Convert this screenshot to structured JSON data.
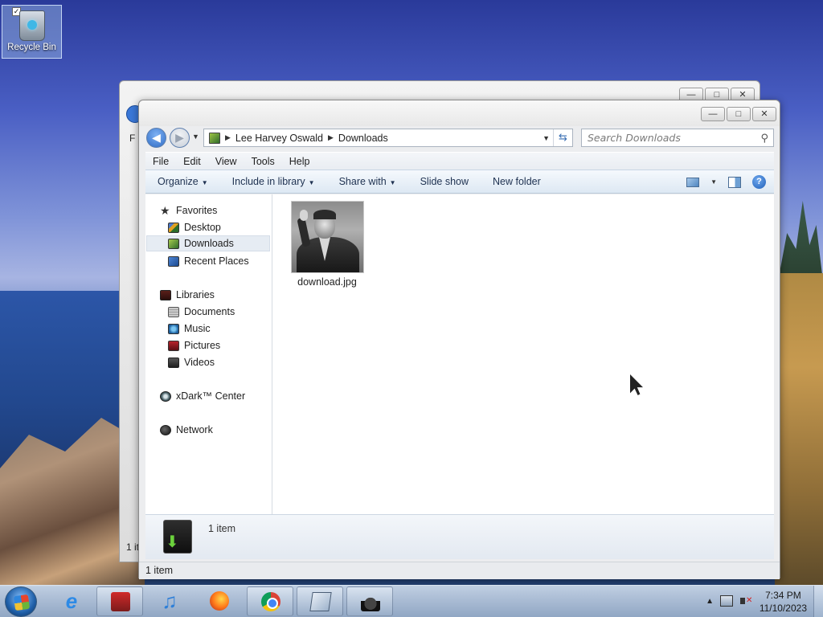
{
  "desktop": {
    "recycle_bin_label": "Recycle Bin"
  },
  "back_window": {
    "menu_fragment": "F",
    "status_fragment": "1 it"
  },
  "window": {
    "title_buttons": {
      "minimize": "—",
      "maximize": "□",
      "close": "✕"
    },
    "breadcrumb": [
      "Lee Harvey Oswald",
      "Downloads"
    ],
    "search_placeholder": "Search Downloads",
    "menu": [
      "File",
      "Edit",
      "View",
      "Tools",
      "Help"
    ],
    "commands": {
      "organize": "Organize",
      "include_in_library": "Include in library",
      "share_with": "Share with",
      "slide_show": "Slide show",
      "new_folder": "New folder"
    },
    "nav_pane": {
      "favorites": "Favorites",
      "desktop": "Desktop",
      "downloads": "Downloads",
      "recent_places": "Recent Places",
      "libraries": "Libraries",
      "documents": "Documents",
      "music": "Music",
      "pictures": "Pictures",
      "videos": "Videos",
      "xdark_center": "xDark™ Center",
      "network": "Network"
    },
    "files": [
      {
        "name": "download.jpg"
      }
    ],
    "details_count": "1 item",
    "status_text": "1 item"
  },
  "taskbar": {
    "apps": [
      "internet-explorer",
      "store",
      "itunes",
      "firefox",
      "chrome",
      "notepad",
      "wizard"
    ],
    "tray_arrow": "▲",
    "time": "7:34 PM",
    "date": "11/10/2023"
  }
}
